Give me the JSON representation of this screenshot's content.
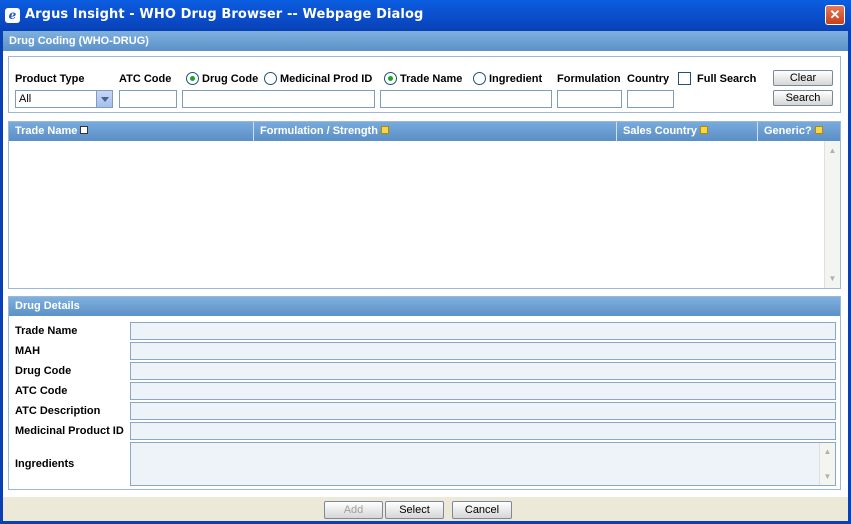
{
  "window": {
    "title": "Argus Insight - WHO Drug Browser -- Webpage Dialog",
    "icon": "ie-icon",
    "close_label": "✕"
  },
  "search": {
    "section_title": "Drug Coding (WHO-DRUG)",
    "product_type_label": "Product Type",
    "product_type_value": "All",
    "atc_code_label": "ATC Code",
    "drug_code_option": "Drug Code",
    "medicinal_prod_option": "Medicinal Prod ID",
    "trade_name_option": "Trade Name",
    "ingredient_option": "Ingredient",
    "formulation_label": "Formulation",
    "country_label": "Country",
    "full_search_label": "Full Search",
    "clear_label": "Clear",
    "search_label": "Search"
  },
  "results": {
    "columns": [
      "Trade Name",
      "Formulation / Strength",
      "Sales Country",
      "Generic?"
    ],
    "rows": []
  },
  "details": {
    "section_title": "Drug Details",
    "fields": [
      "Trade Name",
      "MAH",
      "Drug Code",
      "ATC Code",
      "ATC Description",
      "Medicinal Product ID",
      "Ingredients"
    ]
  },
  "footer": {
    "add_label": "Add",
    "select_label": "Select",
    "cancel_label": "Cancel"
  },
  "colors": {
    "titlebar": "#0a4cc9",
    "section_header": "#6a9fd2",
    "field_bg": "#eef3f9"
  }
}
